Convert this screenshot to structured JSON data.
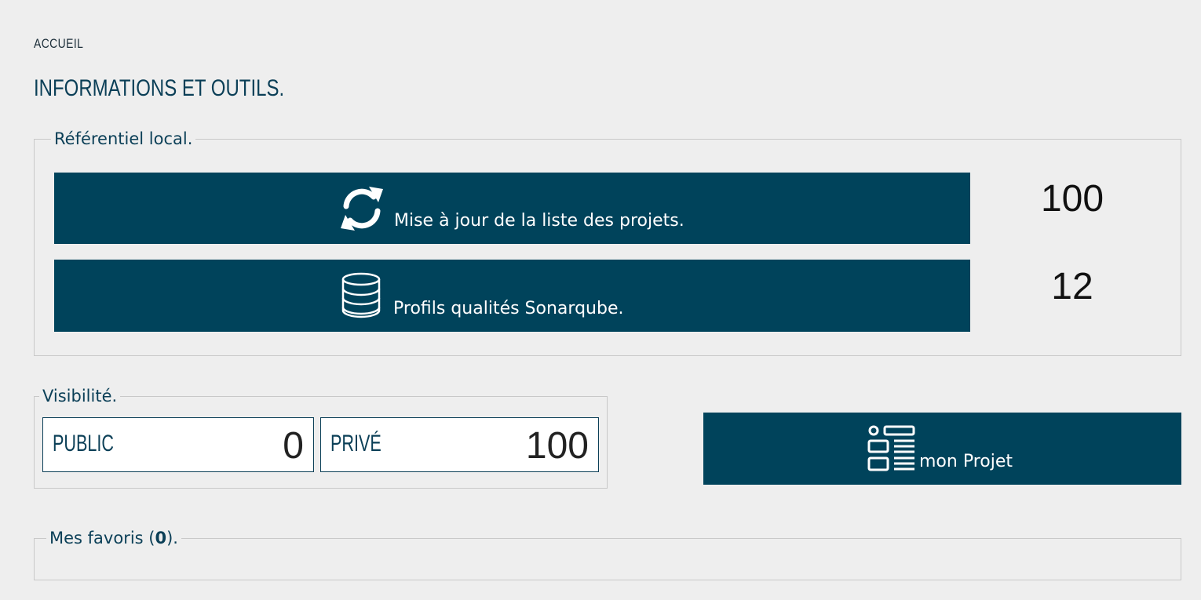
{
  "breadcrumb": "ACCUEIL",
  "page_title": "INFORMATIONS ET OUTILS.",
  "referentiel": {
    "legend": "Référentiel local.",
    "sync_button": {
      "label": "Mise à jour de la liste des projets.",
      "icon": "refresh-icon",
      "count": "100"
    },
    "sonar_button": {
      "label": "Profils qualités Sonarqube.",
      "icon": "database-icon",
      "count": "12"
    }
  },
  "visibilite": {
    "legend": "Visibilité.",
    "public": {
      "label": "PUBLIC",
      "value": "0"
    },
    "prive": {
      "label": "PRIVÉ",
      "value": "100"
    }
  },
  "projet_button": {
    "label": "mon Projet",
    "icon": "list-layout-icon"
  },
  "favoris": {
    "legend_prefix": "Mes favoris (",
    "count": "0",
    "legend_suffix": ")."
  },
  "colors": {
    "primary": "#00435b",
    "background": "#eeeeee",
    "text": "#0b3f57",
    "border": "#c8c8c8"
  }
}
